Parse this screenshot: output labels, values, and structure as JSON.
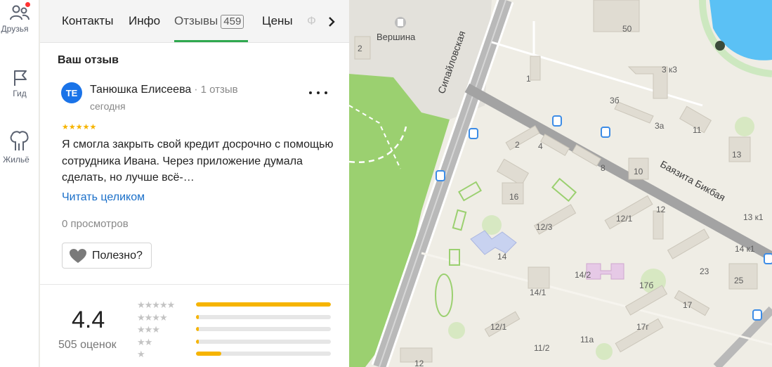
{
  "rail": {
    "items": [
      {
        "label": "Друзья",
        "icon": "friends-icon"
      },
      {
        "label": "Гид",
        "icon": "flag-icon"
      },
      {
        "label": "Жильё",
        "icon": "building-icon"
      }
    ]
  },
  "tabs": {
    "items": [
      "Контакты",
      "Инфо",
      "Отзывы",
      "Цены"
    ],
    "reviews_count": "459",
    "faded_next": "Ф"
  },
  "review": {
    "section_title": "Ваш отзыв",
    "avatar_initials": "ТЕ",
    "author_name": "Танюшка Елисеева",
    "author_sep": "·",
    "author_reviews": "1 отзыв",
    "date": "сегодня",
    "stars": "★★★★★",
    "rating": 5,
    "text": "Я смогла закрыть свой кредит досрочно с помощью сотрудника Ивана. Через приложение думала сделать, но лучше всё-…",
    "read_more": "Читать целиком",
    "views": "0 просмотров",
    "useful_label": "Полезно?"
  },
  "summary": {
    "rating": "4.4",
    "count_text": "505 оценок",
    "distribution": [
      {
        "stars": "★★★★★",
        "fraction": 1.0
      },
      {
        "stars": "★★★★",
        "fraction": 0.02
      },
      {
        "stars": "★★★",
        "fraction": 0.02
      },
      {
        "stars": "★★",
        "fraction": 0.02
      },
      {
        "stars": "★",
        "fraction": 0.19
      }
    ]
  },
  "map": {
    "streets": [
      "Сипайловская",
      "Баязита Бикбая"
    ],
    "places": [
      "Вершина"
    ],
    "house_numbers": [
      "50",
      "2",
      "1",
      "3 к3",
      "3б",
      "3а",
      "11",
      "13",
      "2",
      "4",
      "8",
      "10",
      "16",
      "12/1",
      "12",
      "12/3",
      "13 к1",
      "14 к1",
      "14",
      "14/2",
      "14/1",
      "23",
      "25",
      "17б",
      "17",
      "12/1",
      "17г",
      "11а",
      "11/2",
      "12"
    ]
  },
  "colors": {
    "accent_green": "#2fa84f",
    "link_blue": "#1a6fc9",
    "star_yellow": "#f6b400",
    "avatar_blue": "#1a73e8"
  }
}
